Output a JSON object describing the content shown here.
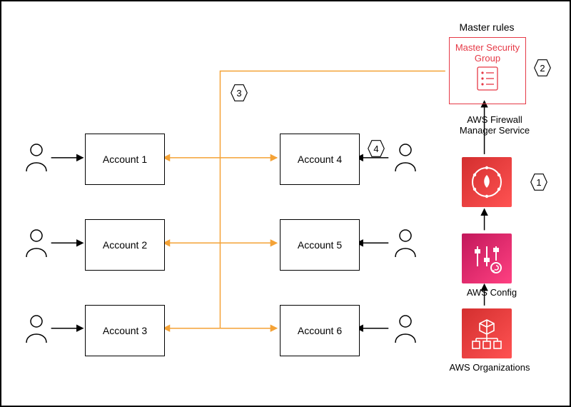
{
  "title_master_rules": "Master rules",
  "master_security_group": "Master Security\nGroup",
  "firewall_label": "AWS Firewall\nManager Service",
  "config_label": "AWS Config",
  "orgs_label": "AWS Organizations",
  "accounts_left": [
    "Account 1",
    "Account 2",
    "Account 3"
  ],
  "accounts_right": [
    "Account 4",
    "Account 5",
    "Account 6"
  ],
  "callouts": {
    "c1": "1",
    "c2": "2",
    "c3": "3",
    "c4": "4"
  },
  "chart_data": {
    "type": "diagram",
    "title": "AWS Firewall Manager – security group policy distribution",
    "nodes": [
      {
        "id": "acc1",
        "label": "Account 1",
        "kind": "account",
        "column": "left",
        "row": 1
      },
      {
        "id": "acc2",
        "label": "Account 2",
        "kind": "account",
        "column": "left",
        "row": 2
      },
      {
        "id": "acc3",
        "label": "Account 3",
        "kind": "account",
        "column": "left",
        "row": 3
      },
      {
        "id": "acc4",
        "label": "Account 4",
        "kind": "account",
        "column": "right",
        "row": 1
      },
      {
        "id": "acc5",
        "label": "Account 5",
        "kind": "account",
        "column": "right",
        "row": 2
      },
      {
        "id": "acc6",
        "label": "Account 6",
        "kind": "account",
        "column": "right",
        "row": 3
      },
      {
        "id": "user1",
        "label": "User",
        "kind": "user",
        "attached_to": "acc1"
      },
      {
        "id": "user2",
        "label": "User",
        "kind": "user",
        "attached_to": "acc2"
      },
      {
        "id": "user3",
        "label": "User",
        "kind": "user",
        "attached_to": "acc3"
      },
      {
        "id": "user4",
        "label": "User",
        "kind": "user",
        "attached_to": "acc4"
      },
      {
        "id": "user5",
        "label": "User",
        "kind": "user",
        "attached_to": "acc5"
      },
      {
        "id": "user6",
        "label": "User",
        "kind": "user",
        "attached_to": "acc6"
      },
      {
        "id": "orgs",
        "label": "AWS Organizations",
        "kind": "aws-service"
      },
      {
        "id": "config",
        "label": "AWS Config",
        "kind": "aws-service"
      },
      {
        "id": "fwm",
        "label": "AWS Firewall Manager Service",
        "kind": "aws-service"
      },
      {
        "id": "msg",
        "label": "Master Security Group",
        "kind": "security-group",
        "group": "Master rules"
      }
    ],
    "edges": [
      {
        "from": "user1",
        "to": "acc1",
        "style": "solid"
      },
      {
        "from": "user2",
        "to": "acc2",
        "style": "solid"
      },
      {
        "from": "user3",
        "to": "acc3",
        "style": "solid"
      },
      {
        "from": "user4",
        "to": "acc4",
        "style": "solid"
      },
      {
        "from": "user5",
        "to": "acc5",
        "style": "solid"
      },
      {
        "from": "user6",
        "to": "acc6",
        "style": "solid"
      },
      {
        "from": "orgs",
        "to": "config",
        "style": "solid"
      },
      {
        "from": "config",
        "to": "fwm",
        "style": "solid"
      },
      {
        "from": "fwm",
        "to": "msg",
        "style": "solid"
      },
      {
        "from": "msg",
        "to": "acc1",
        "style": "distribution",
        "color": "orange",
        "bidirectional": true
      },
      {
        "from": "msg",
        "to": "acc2",
        "style": "distribution",
        "color": "orange",
        "bidirectional": true
      },
      {
        "from": "msg",
        "to": "acc3",
        "style": "distribution",
        "color": "orange",
        "bidirectional": true
      },
      {
        "from": "msg",
        "to": "acc4",
        "style": "distribution",
        "color": "orange",
        "bidirectional": true
      },
      {
        "from": "msg",
        "to": "acc5",
        "style": "distribution",
        "color": "orange",
        "bidirectional": true
      },
      {
        "from": "msg",
        "to": "acc6",
        "style": "distribution",
        "color": "orange",
        "bidirectional": true
      }
    ],
    "callouts": [
      {
        "num": 1,
        "attached_to": "fwm"
      },
      {
        "num": 2,
        "attached_to": "msg"
      },
      {
        "num": 3,
        "attached_to": "distribution-bus"
      },
      {
        "num": 4,
        "attached_to": "acc4"
      }
    ]
  }
}
